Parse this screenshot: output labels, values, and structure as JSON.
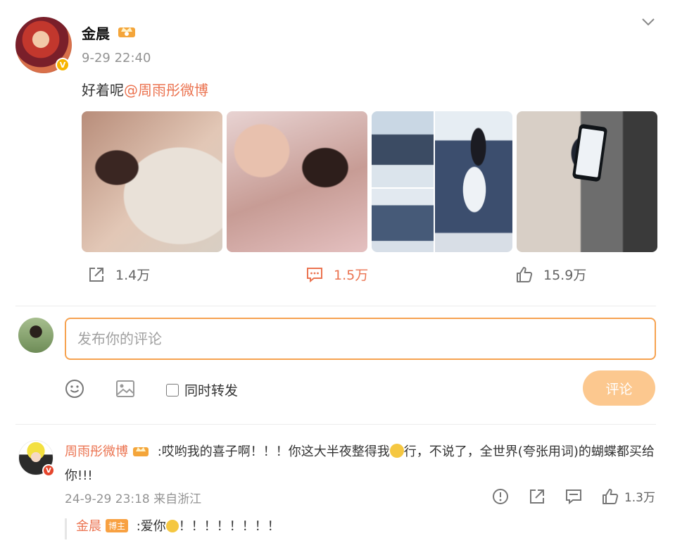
{
  "post": {
    "author": "金晨",
    "time": "9-29 22:40",
    "text": "好着呢",
    "mention": "@周雨彤微博",
    "verified_badge": "V",
    "photos_count_visible": 4,
    "actions": {
      "repost_count": "1.4万",
      "comment_count": "1.5万",
      "like_count": "15.9万"
    }
  },
  "composer": {
    "placeholder": "发布你的评论",
    "repost_label": "同时转发",
    "submit_label": "评论"
  },
  "comment": {
    "user": "周雨彤微博",
    "text_part1": " :哎哟我的喜子啊！！！你这大半夜整得我",
    "text_part2": "行，不说了，全世界(夸张用词)的蝴蝶都买给你!!!",
    "time": "24-9-29 23:18 来自浙江",
    "like_count": "1.3万"
  },
  "reply": {
    "user": "金晨",
    "badge": "博主",
    "text_part1": " :爱你",
    "text_part2": "！！！！！！！！"
  },
  "colors": {
    "accent": "#eb7350",
    "input_border": "#f6a250",
    "submit_bg": "#fcc88f",
    "verified": "#f7b500"
  }
}
